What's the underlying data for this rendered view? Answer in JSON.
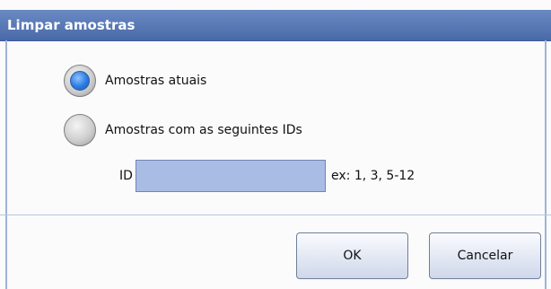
{
  "dialog": {
    "title": "Limpar amostras"
  },
  "options": {
    "current_samples": {
      "label": "Amostras atuais",
      "selected": true
    },
    "samples_with_ids": {
      "label": "Amostras com as seguintes IDs",
      "selected": false
    }
  },
  "id_field": {
    "label": "ID",
    "value": "",
    "hint": "ex: 1, 3, 5-12"
  },
  "buttons": {
    "ok": "OK",
    "cancel": "Cancelar"
  },
  "colors": {
    "titlebar": "#5677b6",
    "input_bg": "#a9bce4",
    "radio_selected": "#2c7be0"
  }
}
